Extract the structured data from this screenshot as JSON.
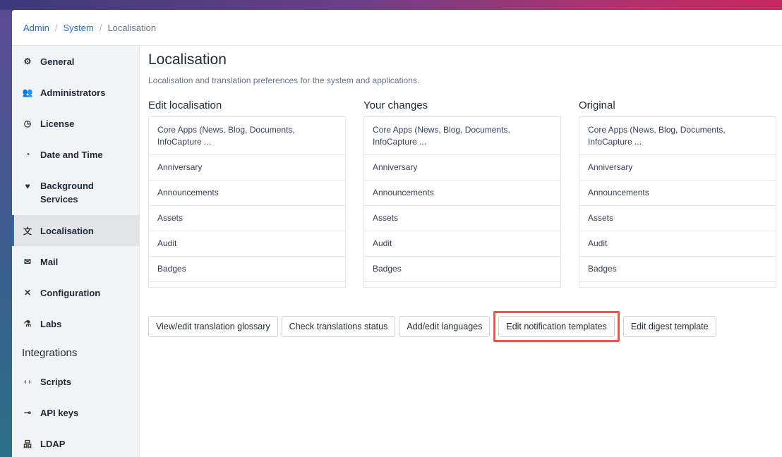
{
  "breadcrumb": {
    "items": [
      "Admin",
      "System",
      "Localisation"
    ],
    "sep": "/"
  },
  "sidebar": {
    "items": [
      {
        "label": "General",
        "icon": "gears-icon",
        "glyph": "⚙"
      },
      {
        "label": "Administrators",
        "icon": "users-icon",
        "glyph": "👥"
      },
      {
        "label": "License",
        "icon": "license-icon",
        "glyph": "◷"
      },
      {
        "label": "Date and Time",
        "icon": "clock-icon",
        "glyph": "◔"
      },
      {
        "label": "Background Services",
        "icon": "heartbeat-icon",
        "glyph": "♥"
      },
      {
        "label": "Localisation",
        "icon": "language-icon",
        "glyph": "文"
      },
      {
        "label": "Mail",
        "icon": "mail-icon",
        "glyph": "✉"
      },
      {
        "label": "Configuration",
        "icon": "tools-icon",
        "glyph": "✕"
      },
      {
        "label": "Labs",
        "icon": "flask-icon",
        "glyph": "⚗"
      }
    ],
    "integrations_heading": "Integrations",
    "integrations": [
      {
        "label": "Scripts",
        "icon": "code-icon",
        "glyph": "‹ ›"
      },
      {
        "label": "API keys",
        "icon": "key-icon",
        "glyph": "⊸"
      },
      {
        "label": "LDAP",
        "icon": "network-icon",
        "glyph": "品"
      }
    ]
  },
  "main": {
    "title": "Localisation",
    "description": "Localisation and translation preferences for the system and applications.",
    "columns": [
      {
        "title": "Edit localisation"
      },
      {
        "title": "Your changes"
      },
      {
        "title": "Original"
      }
    ],
    "items": [
      "Core Apps (News, Blog, Documents, InfoCapture ...",
      "Anniversary",
      "Announcements",
      "Assets",
      "Audit",
      "Badges"
    ],
    "buttons": [
      "View/edit translation glossary",
      "Check translations status",
      "Add/edit languages",
      "Edit notification templates",
      "Edit digest template"
    ]
  },
  "colors": {
    "accent": "#2b6cb0",
    "highlight": "#e8574a"
  }
}
